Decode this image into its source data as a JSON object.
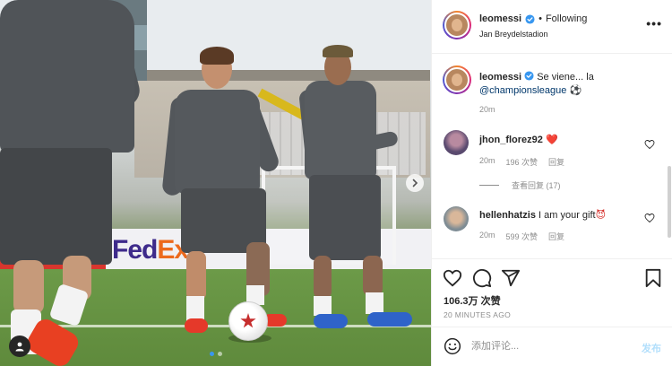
{
  "header": {
    "username": "leomessi",
    "separator": "•",
    "follow_status": "Following",
    "location": "Jan Breydelstadion",
    "more_icon": "more-horizontal-icon"
  },
  "caption": {
    "username": "leomessi",
    "text": "Se viene... la ",
    "mention": "@championsleague",
    "emoji": "⚽",
    "time": "20m"
  },
  "comments": [
    {
      "username": "jhon_florez92",
      "text": "",
      "emoji": "❤️",
      "time": "20m",
      "likes": "196 次赞",
      "reply_label": "回复",
      "view_replies": "查看回复 (17)"
    },
    {
      "username": "hellenhatzis",
      "text": "I am your gift",
      "emoji": "😈",
      "time": "20m",
      "likes": "599 次赞",
      "reply_label": "回复"
    }
  ],
  "stats": {
    "likes": "106.3万 次赞",
    "time_ago": "20 MINUTES AGO"
  },
  "composer": {
    "placeholder": "添加评论...",
    "post_label": "发布"
  },
  "media": {
    "ad_brand": "FedEx",
    "carousel_count": 2,
    "carousel_active": 0
  },
  "colors": {
    "verified": "#3897f0",
    "link": "#00376b",
    "muted": "#8e8e8e",
    "post_button": "#b2dffc",
    "heart": "#ed4956"
  }
}
